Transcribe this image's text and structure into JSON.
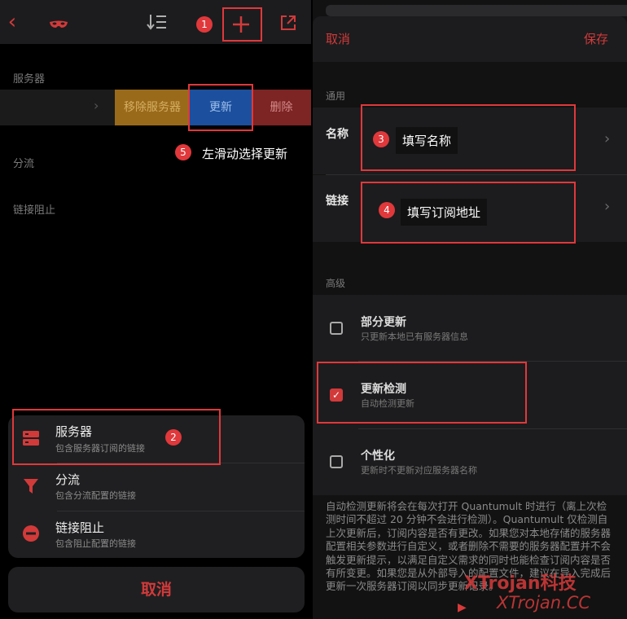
{
  "left": {
    "topbar": {
      "back_icon": "chevron-left-icon",
      "mask_icon": "mask-icon",
      "sort_icon": "sort-icon",
      "add_icon": "plus-icon",
      "share_icon": "share-icon"
    },
    "annotations": {
      "n1": "1",
      "n2": "2",
      "n5": "5"
    },
    "section_server": "服务器",
    "row_actions": {
      "remove": "移除服务器",
      "update": "更新",
      "delete": "删除"
    },
    "hint": "左滑动选择更新",
    "section_filter": "分流",
    "section_block": "链接阻止",
    "sheet": [
      {
        "title": "服务器",
        "subtitle": "包含服务器订阅的链接",
        "icon": "server-icon"
      },
      {
        "title": "分流",
        "subtitle": "包含分流配置的链接",
        "icon": "filter-icon"
      },
      {
        "title": "链接阻止",
        "subtitle": "包含阻止配置的链接",
        "icon": "block-icon"
      }
    ],
    "cancel": "取消"
  },
  "right": {
    "header": {
      "cancel": "取消",
      "save": "保存"
    },
    "section_general": "通用",
    "name_label": "名称",
    "link_label": "链接",
    "name_tip": "填写名称",
    "link_tip": "填写订阅地址",
    "annotations": {
      "n3": "3",
      "n4": "4"
    },
    "section_advanced": "高级",
    "options": [
      {
        "title": "部分更新",
        "subtitle": "只更新本地已有服务器信息",
        "checked": false
      },
      {
        "title": "更新检测",
        "subtitle": "自动检测更新",
        "checked": true
      },
      {
        "title": "个性化",
        "subtitle": "更新时不更新对应服务器名称",
        "checked": false
      }
    ],
    "footnote": "自动检测更新将会在每次打开 Quantumult 时进行（离上次检测时间不超过 20 分钟不会进行检测）。Quantumult 仅检测自上次更新后，订阅内容是否有更改。如果您对本地存储的服务器配置相关参数进行自定义，或者删除不需要的服务器配置并不会触发更新提示，以满足自定义需求的同时也能检查订阅内容是否有所变更。如果您是从外部导入的配置文件，建议在导入完成后更新一次服务器订阅以同步更新记录。",
    "watermark_cn": "XTrojan科技",
    "watermark_en": "XTrojan.CC"
  },
  "colors": {
    "accent": "#d23a3a",
    "annotation": "#e0383b",
    "update_blue": "#1c4f9d",
    "remove_orange": "#9a6a1b",
    "delete_red": "#7d2424"
  }
}
